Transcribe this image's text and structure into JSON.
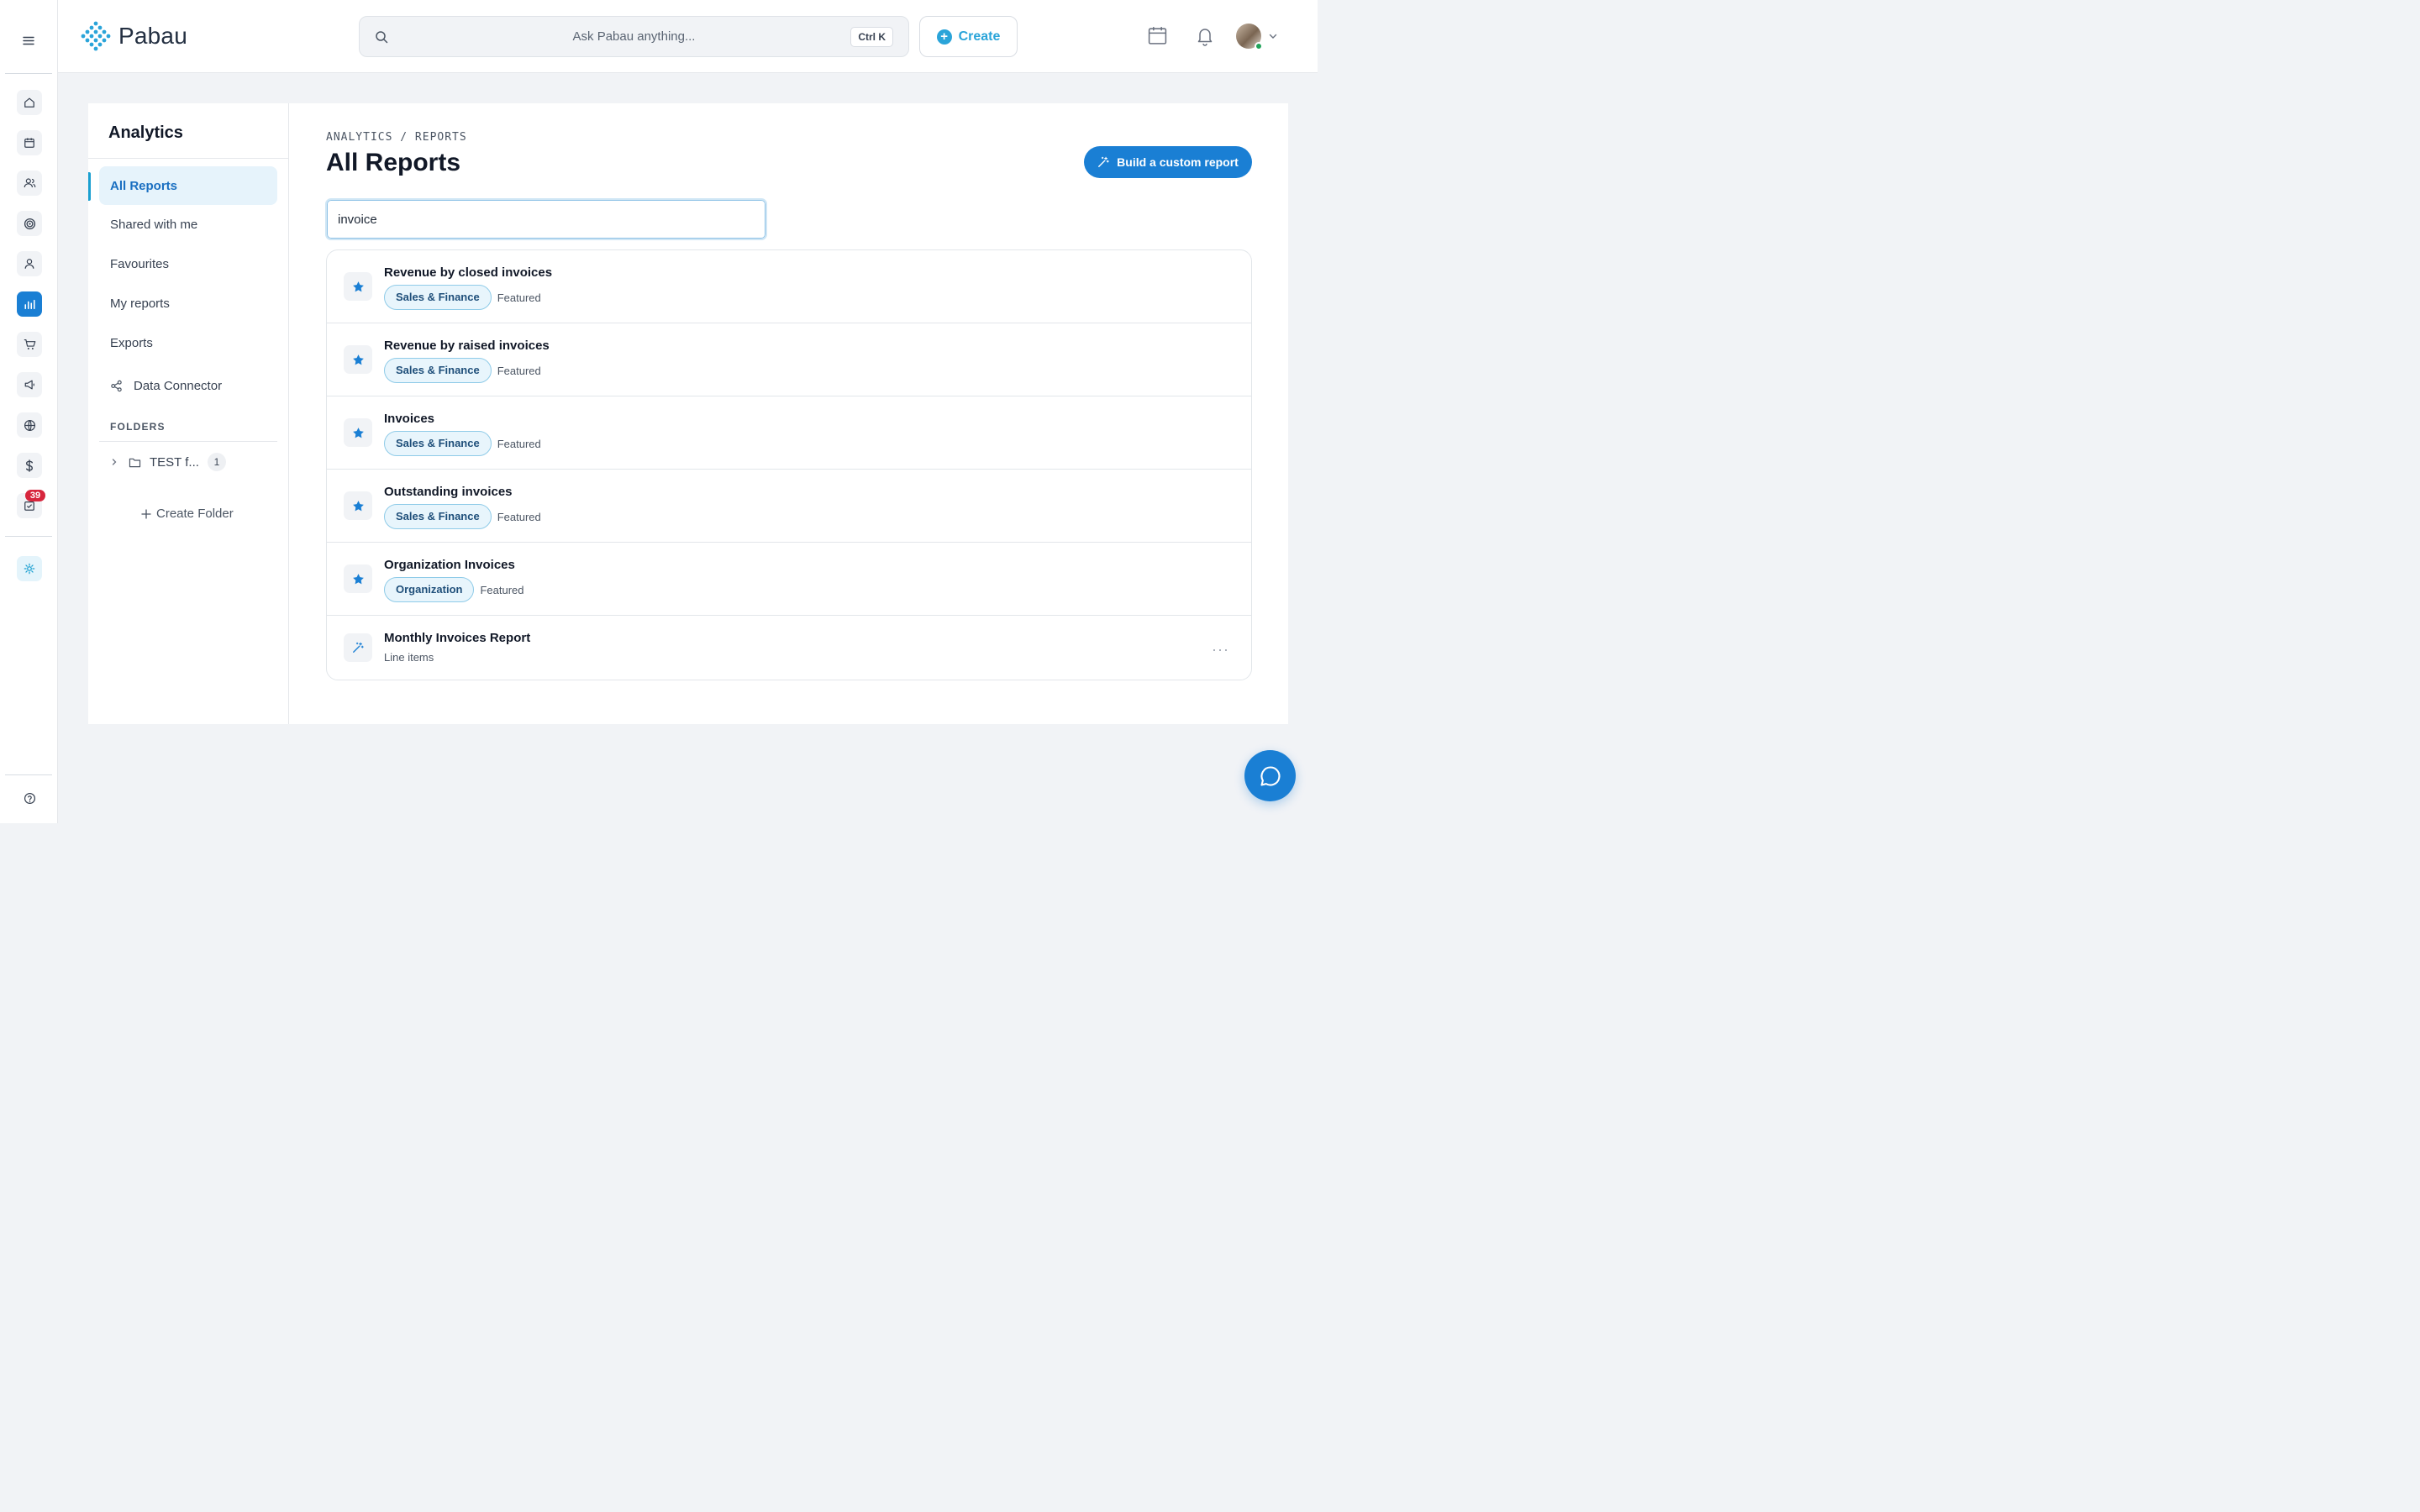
{
  "topbar": {
    "logo_text": "Pabau",
    "search_placeholder": "Ask Pabau anything...",
    "shortcut": "Ctrl K",
    "create_label": "Create"
  },
  "rail": {
    "icons": [
      "home-icon",
      "calendar-icon",
      "clients-icon",
      "target-icon",
      "user-icon",
      "analytics-icon",
      "cart-icon",
      "megaphone-icon",
      "globe-icon",
      "dollar-icon",
      "tasks-icon",
      "sun-icon",
      "help-icon"
    ],
    "active": "analytics-icon",
    "tasks_badge": "39"
  },
  "subnav": {
    "title": "Analytics",
    "items": [
      {
        "label": "All Reports",
        "active": true
      },
      {
        "label": "Shared with me"
      },
      {
        "label": "Favourites"
      },
      {
        "label": "My reports"
      },
      {
        "label": "Exports"
      },
      {
        "label": "Data Connector"
      }
    ],
    "folders_label": "FOLDERS",
    "folder": {
      "name": "TEST f...",
      "count": "1"
    },
    "create_folder_label": "Create Folder"
  },
  "main": {
    "breadcrumb": "ANALYTICS / REPORTS",
    "title": "All Reports",
    "build_button_label": "Build a custom report",
    "search_value": "invoice"
  },
  "reports": [
    {
      "title": "Revenue by closed invoices",
      "tag": "Sales & Finance",
      "meta": "Featured",
      "icon": "star-icon"
    },
    {
      "title": "Revenue by raised invoices",
      "tag": "Sales & Finance",
      "meta": "Featured",
      "icon": "star-icon"
    },
    {
      "title": "Invoices",
      "tag": "Sales & Finance",
      "meta": "Featured",
      "icon": "star-icon"
    },
    {
      "title": "Outstanding invoices",
      "tag": "Sales & Finance",
      "meta": "Featured",
      "icon": "star-icon"
    },
    {
      "title": "Organization Invoices",
      "tag": "Organization",
      "meta": "Featured",
      "icon": "star-icon"
    },
    {
      "title": "Monthly Invoices Report",
      "subtitle": "Line items",
      "icon": "magic-wand-icon"
    }
  ],
  "colors": {
    "primary": "#1a7fd4",
    "accent": "#2aa4d9",
    "tag_bg": "#e8f5fc",
    "badge": "#d7263d"
  }
}
